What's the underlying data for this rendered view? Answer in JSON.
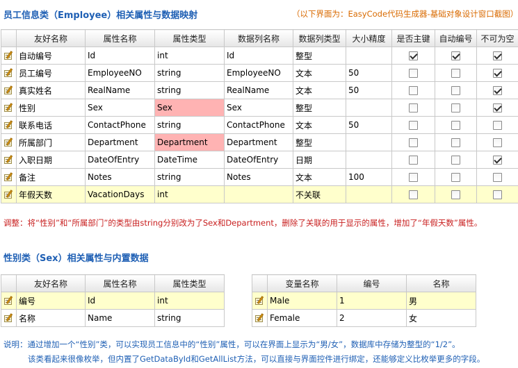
{
  "employee": {
    "title": "员工信息类（Employee）相关属性与数据映射",
    "source_note": "（以下界面为：EasyCode代码生成器-基础对象设计窗口截图）",
    "columns": [
      "友好名称",
      "属性名称",
      "属性类型",
      "数据列名称",
      "数据列类型",
      "大小精度",
      "是否主键",
      "自动编号",
      "不可为空"
    ],
    "rows": [
      {
        "friendly": "自动编号",
        "prop": "Id",
        "type": "int",
        "column": "Id",
        "coltype": "整型",
        "size": "",
        "pk": true,
        "auto": true,
        "notnull": true,
        "highlight": false,
        "pink": false
      },
      {
        "friendly": "员工编号",
        "prop": "EmployeeNO",
        "type": "string",
        "column": "EmployeeNO",
        "coltype": "文本",
        "size": "50",
        "pk": false,
        "auto": false,
        "notnull": true,
        "highlight": false,
        "pink": false
      },
      {
        "friendly": "真实姓名",
        "prop": "RealName",
        "type": "string",
        "column": "RealName",
        "coltype": "文本",
        "size": "50",
        "pk": false,
        "auto": false,
        "notnull": true,
        "highlight": false,
        "pink": false
      },
      {
        "friendly": "性别",
        "prop": "Sex",
        "type": "Sex",
        "column": "Sex",
        "coltype": "整型",
        "size": "",
        "pk": false,
        "auto": false,
        "notnull": true,
        "highlight": false,
        "pink": true
      },
      {
        "friendly": "联系电话",
        "prop": "ContactPhone",
        "type": "string",
        "column": "ContactPhone",
        "coltype": "文本",
        "size": "50",
        "pk": false,
        "auto": false,
        "notnull": false,
        "highlight": false,
        "pink": false
      },
      {
        "friendly": "所属部门",
        "prop": "Department",
        "type": "Department",
        "column": "Department",
        "coltype": "整型",
        "size": "",
        "pk": false,
        "auto": false,
        "notnull": false,
        "highlight": false,
        "pink": true
      },
      {
        "friendly": "入职日期",
        "prop": "DateOfEntry",
        "type": "DateTime",
        "column": "DateOfEntry",
        "coltype": "日期",
        "size": "",
        "pk": false,
        "auto": false,
        "notnull": true,
        "highlight": false,
        "pink": false
      },
      {
        "friendly": "备注",
        "prop": "Notes",
        "type": "string",
        "column": "Notes",
        "coltype": "文本",
        "size": "100",
        "pk": false,
        "auto": false,
        "notnull": false,
        "highlight": false,
        "pink": false
      },
      {
        "friendly": "年假天数",
        "prop": "VacationDays",
        "type": "int",
        "column": "",
        "coltype": "不关联",
        "size": "",
        "pk": false,
        "auto": false,
        "notnull": false,
        "highlight": true,
        "pink": false
      }
    ],
    "adjust_note": "调整：将“性别”和“所属部门”的类型由string分别改为了Sex和Department，删除了关联的用于显示的属性，增加了“年假天数”属性。"
  },
  "sex": {
    "title": "性别类（Sex）相关属性与内置数据",
    "prop_columns": [
      "友好名称",
      "属性名称",
      "属性类型"
    ],
    "prop_rows": [
      {
        "friendly": "编号",
        "prop": "Id",
        "type": "int",
        "highlight": true
      },
      {
        "friendly": "名称",
        "prop": "Name",
        "type": "string",
        "highlight": false
      }
    ],
    "value_columns": [
      "变量名称",
      "编号",
      "名称"
    ],
    "value_rows": [
      {
        "var": "Male",
        "id": "1",
        "name": "男",
        "highlight": true
      },
      {
        "var": "Female",
        "id": "2",
        "name": "女",
        "highlight": false
      }
    ],
    "desc_line1": "说明：通过增加一个“性别”类，可以实现员工信息中的“性别”属性，可以在界面上显示为“男/女”，数据库中存储为整型的“1/2”。",
    "desc_line2": "该类看起来很像枚举，但内置了GetDataById和GetAllList方法，可以直接与界面控件进行绑定，还能够定义比枚举更多的字段。"
  },
  "icons": {
    "row_icon": "edit-row-icon",
    "checkbox": "checkbox-icon"
  }
}
